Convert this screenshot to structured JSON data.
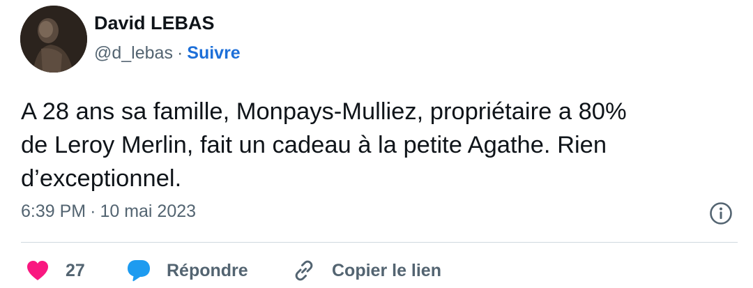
{
  "author": {
    "display_name": "David LEBAS",
    "handle": "@d_lebas",
    "separator": "·",
    "follow_label": "Suivre"
  },
  "tweet": {
    "text_lines": [
      "A 28 ans sa famille, Monpays-Mulliez, propriétaire a 80%",
      "de Leroy Merlin, fait un cadeau à la petite Agathe. Rien",
      "d’exceptionnel."
    ],
    "time": "6:39 PM",
    "separator": "·",
    "date": "10 mai 2023"
  },
  "actions": {
    "like_count": "27",
    "reply_label": "Répondre",
    "copy_link_label": "Copier le lien"
  },
  "icons": {
    "info": "info-icon",
    "heart": "heart-icon",
    "reply": "speech-bubble-icon",
    "link": "link-icon"
  },
  "colors": {
    "accent": "#1d6fd8",
    "heart": "#f91880",
    "reply": "#1d9bf0",
    "muted": "#536471",
    "text": "#0f1419"
  }
}
